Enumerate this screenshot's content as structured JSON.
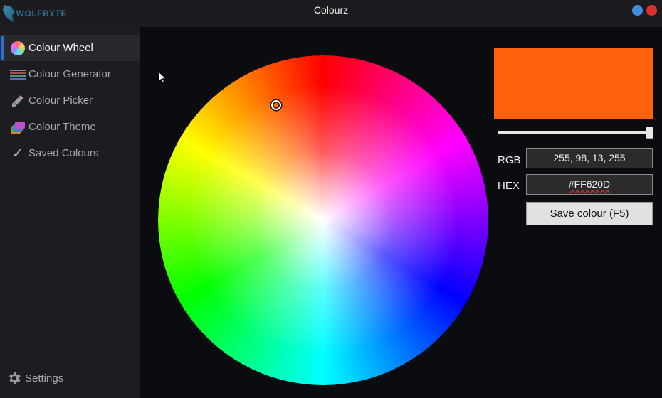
{
  "titlebar": {
    "logo_text": "WOLFBYTE",
    "title": "Colourz",
    "minimize_color": "#3f8ed9",
    "close_color": "#d9302e"
  },
  "sidebar": {
    "items": [
      {
        "label": "Colour Wheel",
        "icon": "colour-wheel-icon",
        "active": true
      },
      {
        "label": "Colour Generator",
        "icon": "colour-generator-icon",
        "active": false
      },
      {
        "label": "Colour Picker",
        "icon": "eyedropper-icon",
        "active": false
      },
      {
        "label": "Colour Theme",
        "icon": "colour-theme-icon",
        "active": false
      },
      {
        "label": "Saved Colours",
        "icon": "checkmark-icon",
        "active": false
      }
    ],
    "settings_label": "Settings",
    "accent_color": "#2f6fd9"
  },
  "colour": {
    "preview_hex": "#FF620D",
    "alpha_percent": 100,
    "rgb_label": "RGB",
    "rgb_value": "255, 98, 13, 255",
    "hex_label": "HEX",
    "hex_value": "#FF620D",
    "save_button": "Save colour (F5)"
  }
}
